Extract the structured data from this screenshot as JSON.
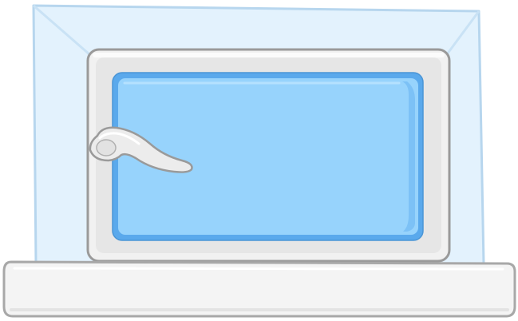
{
  "scene": {
    "object": "window-with-handle",
    "window_state": "closed"
  },
  "colors": {
    "background": "#ffffff",
    "recess_fill": "#e3f2fd",
    "recess_stroke": "#b7d6ee",
    "recess_bevel": "#c9e2f5",
    "frame_fill": "#f1f1f1",
    "frame_stroke": "#9a9a9a",
    "glass_border": "#5aa9ec",
    "glass_fill": "#97d3fc",
    "glass_shade": "#7cc1f6",
    "handle_fill": "#ececec",
    "handle_stroke": "#9a9a9a",
    "sill_fill": "#f4f4f4",
    "sill_stroke": "#a8a8a8"
  },
  "icons": {
    "window": "window-icon",
    "handle": "handle-icon"
  }
}
